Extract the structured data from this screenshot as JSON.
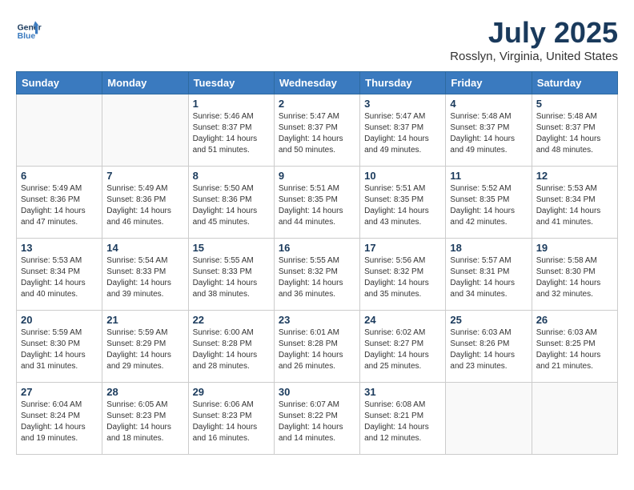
{
  "header": {
    "logo_line1": "General",
    "logo_line2": "Blue",
    "title": "July 2025",
    "subtitle": "Rosslyn, Virginia, United States"
  },
  "weekdays": [
    "Sunday",
    "Monday",
    "Tuesday",
    "Wednesday",
    "Thursday",
    "Friday",
    "Saturday"
  ],
  "weeks": [
    [
      {
        "day": "",
        "info": ""
      },
      {
        "day": "",
        "info": ""
      },
      {
        "day": "1",
        "info": "Sunrise: 5:46 AM\nSunset: 8:37 PM\nDaylight: 14 hours and 51 minutes."
      },
      {
        "day": "2",
        "info": "Sunrise: 5:47 AM\nSunset: 8:37 PM\nDaylight: 14 hours and 50 minutes."
      },
      {
        "day": "3",
        "info": "Sunrise: 5:47 AM\nSunset: 8:37 PM\nDaylight: 14 hours and 49 minutes."
      },
      {
        "day": "4",
        "info": "Sunrise: 5:48 AM\nSunset: 8:37 PM\nDaylight: 14 hours and 49 minutes."
      },
      {
        "day": "5",
        "info": "Sunrise: 5:48 AM\nSunset: 8:37 PM\nDaylight: 14 hours and 48 minutes."
      }
    ],
    [
      {
        "day": "6",
        "info": "Sunrise: 5:49 AM\nSunset: 8:36 PM\nDaylight: 14 hours and 47 minutes."
      },
      {
        "day": "7",
        "info": "Sunrise: 5:49 AM\nSunset: 8:36 PM\nDaylight: 14 hours and 46 minutes."
      },
      {
        "day": "8",
        "info": "Sunrise: 5:50 AM\nSunset: 8:36 PM\nDaylight: 14 hours and 45 minutes."
      },
      {
        "day": "9",
        "info": "Sunrise: 5:51 AM\nSunset: 8:35 PM\nDaylight: 14 hours and 44 minutes."
      },
      {
        "day": "10",
        "info": "Sunrise: 5:51 AM\nSunset: 8:35 PM\nDaylight: 14 hours and 43 minutes."
      },
      {
        "day": "11",
        "info": "Sunrise: 5:52 AM\nSunset: 8:35 PM\nDaylight: 14 hours and 42 minutes."
      },
      {
        "day": "12",
        "info": "Sunrise: 5:53 AM\nSunset: 8:34 PM\nDaylight: 14 hours and 41 minutes."
      }
    ],
    [
      {
        "day": "13",
        "info": "Sunrise: 5:53 AM\nSunset: 8:34 PM\nDaylight: 14 hours and 40 minutes."
      },
      {
        "day": "14",
        "info": "Sunrise: 5:54 AM\nSunset: 8:33 PM\nDaylight: 14 hours and 39 minutes."
      },
      {
        "day": "15",
        "info": "Sunrise: 5:55 AM\nSunset: 8:33 PM\nDaylight: 14 hours and 38 minutes."
      },
      {
        "day": "16",
        "info": "Sunrise: 5:55 AM\nSunset: 8:32 PM\nDaylight: 14 hours and 36 minutes."
      },
      {
        "day": "17",
        "info": "Sunrise: 5:56 AM\nSunset: 8:32 PM\nDaylight: 14 hours and 35 minutes."
      },
      {
        "day": "18",
        "info": "Sunrise: 5:57 AM\nSunset: 8:31 PM\nDaylight: 14 hours and 34 minutes."
      },
      {
        "day": "19",
        "info": "Sunrise: 5:58 AM\nSunset: 8:30 PM\nDaylight: 14 hours and 32 minutes."
      }
    ],
    [
      {
        "day": "20",
        "info": "Sunrise: 5:59 AM\nSunset: 8:30 PM\nDaylight: 14 hours and 31 minutes."
      },
      {
        "day": "21",
        "info": "Sunrise: 5:59 AM\nSunset: 8:29 PM\nDaylight: 14 hours and 29 minutes."
      },
      {
        "day": "22",
        "info": "Sunrise: 6:00 AM\nSunset: 8:28 PM\nDaylight: 14 hours and 28 minutes."
      },
      {
        "day": "23",
        "info": "Sunrise: 6:01 AM\nSunset: 8:28 PM\nDaylight: 14 hours and 26 minutes."
      },
      {
        "day": "24",
        "info": "Sunrise: 6:02 AM\nSunset: 8:27 PM\nDaylight: 14 hours and 25 minutes."
      },
      {
        "day": "25",
        "info": "Sunrise: 6:03 AM\nSunset: 8:26 PM\nDaylight: 14 hours and 23 minutes."
      },
      {
        "day": "26",
        "info": "Sunrise: 6:03 AM\nSunset: 8:25 PM\nDaylight: 14 hours and 21 minutes."
      }
    ],
    [
      {
        "day": "27",
        "info": "Sunrise: 6:04 AM\nSunset: 8:24 PM\nDaylight: 14 hours and 19 minutes."
      },
      {
        "day": "28",
        "info": "Sunrise: 6:05 AM\nSunset: 8:23 PM\nDaylight: 14 hours and 18 minutes."
      },
      {
        "day": "29",
        "info": "Sunrise: 6:06 AM\nSunset: 8:23 PM\nDaylight: 14 hours and 16 minutes."
      },
      {
        "day": "30",
        "info": "Sunrise: 6:07 AM\nSunset: 8:22 PM\nDaylight: 14 hours and 14 minutes."
      },
      {
        "day": "31",
        "info": "Sunrise: 6:08 AM\nSunset: 8:21 PM\nDaylight: 14 hours and 12 minutes."
      },
      {
        "day": "",
        "info": ""
      },
      {
        "day": "",
        "info": ""
      }
    ]
  ]
}
